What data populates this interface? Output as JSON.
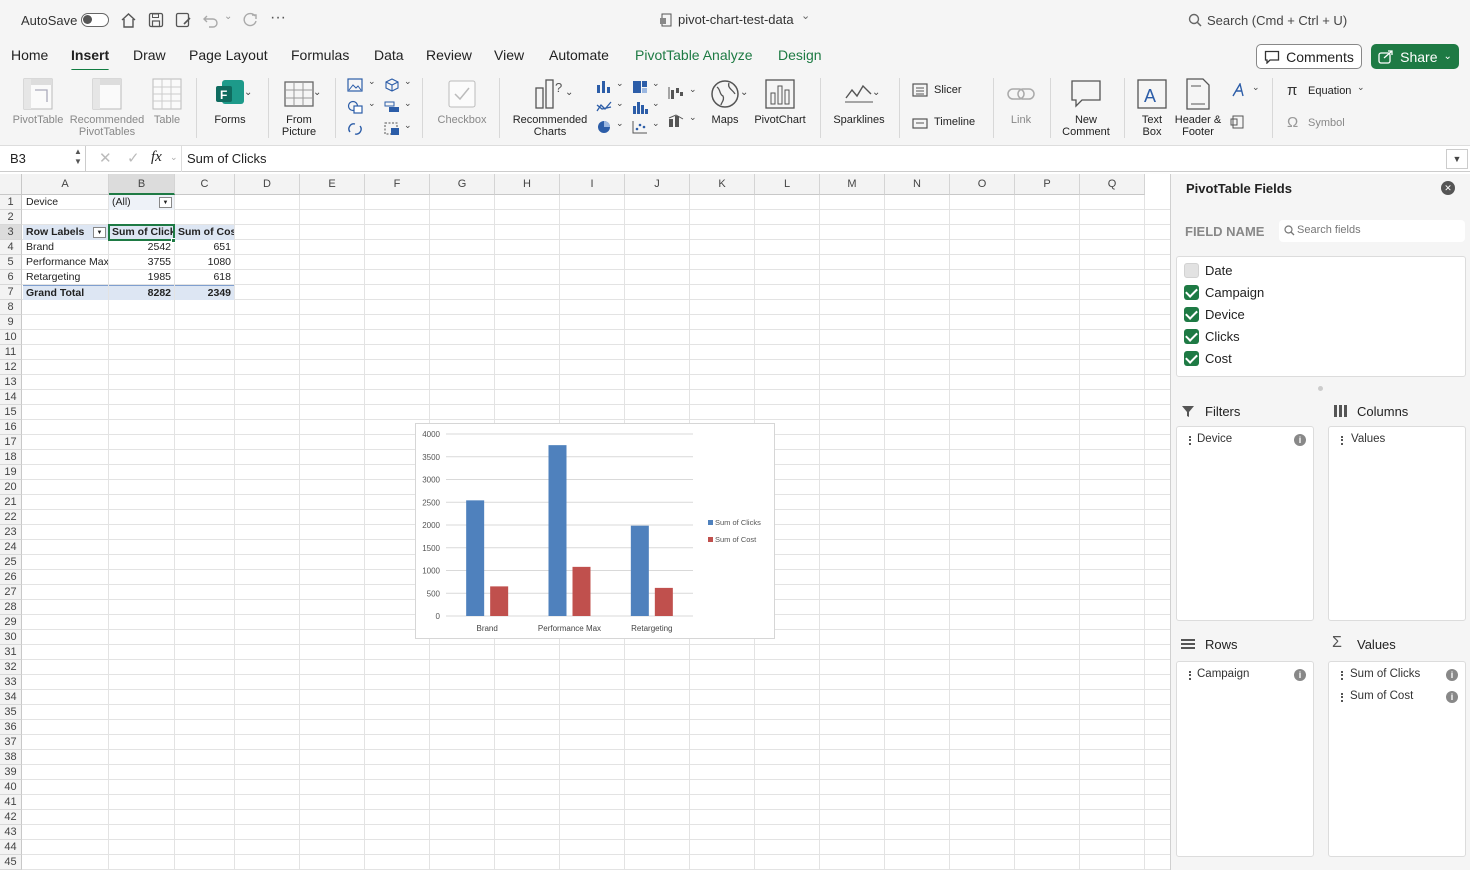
{
  "titlebar": {
    "autosave": "AutoSave",
    "filename": "pivot-chart-test-data",
    "search": "Search (Cmd + Ctrl + U)"
  },
  "menu": {
    "tabs": [
      "Home",
      "Insert",
      "Draw",
      "Page Layout",
      "Formulas",
      "Data",
      "Review",
      "View",
      "Automate",
      "PivotTable Analyze",
      "Design"
    ],
    "comments": "Comments",
    "share": "Share"
  },
  "ribbon": {
    "pivottable": "PivotTable",
    "recommended_pivot_1": "Recommended",
    "recommended_pivot_2": "PivotTables",
    "table": "Table",
    "forms": "Forms",
    "from_picture_1": "From",
    "from_picture_2": "Picture",
    "checkbox": "Checkbox",
    "recommended_charts_1": "Recommended",
    "recommended_charts_2": "Charts",
    "maps": "Maps",
    "pivotchart": "PivotChart",
    "sparklines": "Sparklines",
    "slicer": "Slicer",
    "timeline": "Timeline",
    "link": "Link",
    "new_comment_1": "New",
    "new_comment_2": "Comment",
    "text_box_1": "Text",
    "text_box_2": "Box",
    "header_footer_1": "Header &",
    "header_footer_2": "Footer",
    "equation": "Equation",
    "symbol": "Symbol"
  },
  "formula_bar": {
    "name_box": "B3",
    "fx": "fx",
    "formula": "Sum of Clicks"
  },
  "grid": {
    "columns": [
      "A",
      "B",
      "C",
      "D",
      "E",
      "F",
      "G",
      "H",
      "I",
      "J",
      "K",
      "L",
      "M",
      "N",
      "O",
      "P",
      "Q"
    ],
    "rows": [
      "1",
      "2",
      "3",
      "4",
      "5",
      "6",
      "7",
      "8",
      "9",
      "10",
      "11",
      "12",
      "13",
      "14",
      "15",
      "16",
      "17",
      "18",
      "19",
      "20",
      "21",
      "22",
      "23",
      "24",
      "25",
      "26",
      "27",
      "28",
      "29",
      "30",
      "31",
      "32",
      "33",
      "34",
      "35",
      "36",
      "37",
      "38",
      "39",
      "40",
      "41",
      "42",
      "43",
      "44",
      "45"
    ],
    "filter_label": "Device",
    "filter_value": "(All)",
    "header": {
      "a": "Row Labels",
      "b": "Sum of Clicks",
      "c": "Sum of Cost"
    },
    "data": [
      {
        "label": "Brand",
        "clicks": "2542",
        "cost": "651"
      },
      {
        "label": "Performance Max",
        "clicks": "3755",
        "cost": "1080"
      },
      {
        "label": "Retargeting",
        "clicks": "1985",
        "cost": "618"
      }
    ],
    "total": {
      "label": "Grand Total",
      "clicks": "8282",
      "cost": "2349"
    }
  },
  "chart_data": {
    "type": "bar",
    "categories": [
      "Brand",
      "Performance Max",
      "Retargeting"
    ],
    "series": [
      {
        "name": "Sum of Clicks",
        "values": [
          2542,
          3755,
          1985
        ],
        "color": "#4f81bd"
      },
      {
        "name": "Sum of Cost",
        "values": [
          651,
          1080,
          618
        ],
        "color": "#c0504d"
      }
    ],
    "ylim": [
      0,
      4000
    ],
    "yticks": [
      "0",
      "500",
      "1000",
      "1500",
      "2000",
      "2500",
      "3000",
      "3500",
      "4000"
    ],
    "legend": "right",
    "grid": true
  },
  "pane": {
    "title": "PivotTable Fields",
    "field_name": "FIELD NAME",
    "search_placeholder": "Search fields",
    "fields": [
      {
        "label": "Date",
        "checked": false
      },
      {
        "label": "Campaign",
        "checked": true
      },
      {
        "label": "Device",
        "checked": true
      },
      {
        "label": "Clicks",
        "checked": true
      },
      {
        "label": "Cost",
        "checked": true
      }
    ],
    "filters_title": "Filters",
    "filters": [
      "Device"
    ],
    "columns_title": "Columns",
    "columns": [
      "Values"
    ],
    "rows_title": "Rows",
    "rows": [
      "Campaign"
    ],
    "values_title": "Values",
    "values": [
      "Sum of Clicks",
      "Sum of Cost"
    ]
  }
}
